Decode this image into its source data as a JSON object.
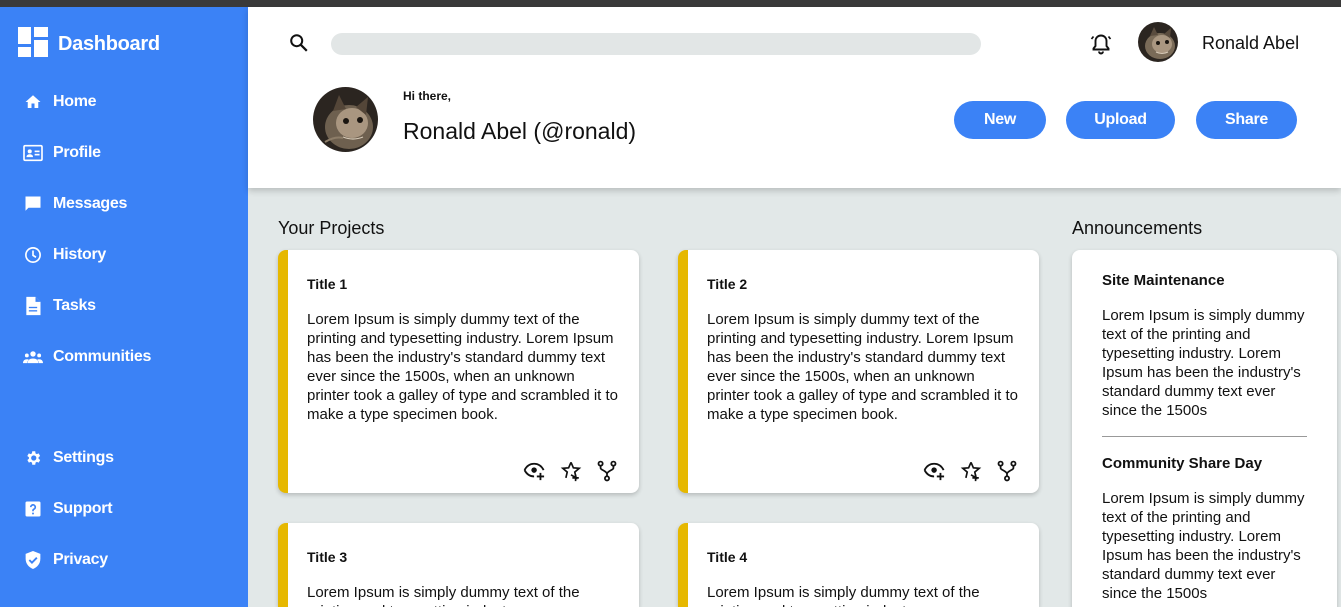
{
  "sidebar": {
    "brand": "Dashboard",
    "items": [
      {
        "label": "Home",
        "icon": "home-icon"
      },
      {
        "label": "Profile",
        "icon": "profile-card-icon"
      },
      {
        "label": "Messages",
        "icon": "chat-icon"
      },
      {
        "label": "History",
        "icon": "clock-icon"
      },
      {
        "label": "Tasks",
        "icon": "document-icon"
      },
      {
        "label": "Communities",
        "icon": "group-icon"
      }
    ],
    "bottom_items": [
      {
        "label": "Settings",
        "icon": "gear-icon"
      },
      {
        "label": "Support",
        "icon": "help-icon"
      },
      {
        "label": "Privacy",
        "icon": "shield-icon"
      }
    ]
  },
  "header": {
    "search_placeholder": "",
    "user_name": "Ronald Abel",
    "greeting": "Hi there,",
    "handle": "Ronald Abel (@ronald)",
    "buttons": {
      "new": "New",
      "upload": "Upload",
      "share": "Share"
    }
  },
  "projects": {
    "title": "Your Projects",
    "cards": [
      {
        "title": "Title 1",
        "body": "Lorem Ipsum is simply dummy text of the printing and typesetting industry. Lorem Ipsum has been the industry's standard dummy text ever since the 1500s, when an unknown printer took a galley of type and scrambled it to make a type specimen book."
      },
      {
        "title": "Title 2",
        "body": "Lorem Ipsum is simply dummy text of the printing and typesetting industry. Lorem Ipsum has been the industry's standard dummy text ever since the 1500s, when an unknown printer took a galley of type and scrambled it to make a type specimen book."
      },
      {
        "title": "Title 3",
        "body": "Lorem Ipsum is simply dummy text of the printing and typesetting industry."
      },
      {
        "title": "Title 4",
        "body": "Lorem Ipsum is simply dummy text of the printing and typesetting industry."
      }
    ]
  },
  "announcements": {
    "title": "Announcements",
    "items": [
      {
        "title": "Site Maintenance",
        "body": "Lorem Ipsum is simply dummy text of the printing and typesetting industry. Lorem Ipsum has been the industry's standard dummy text ever since the 1500s"
      },
      {
        "title": "Community Share Day",
        "body": "Lorem Ipsum is simply dummy text of the printing and typesetting industry. Lorem Ipsum has been the industry's standard dummy text ever since the 1500s"
      }
    ]
  },
  "colors": {
    "accent": "#3b82f6",
    "card_border": "#e6b800",
    "background": "#e2e8e8"
  }
}
